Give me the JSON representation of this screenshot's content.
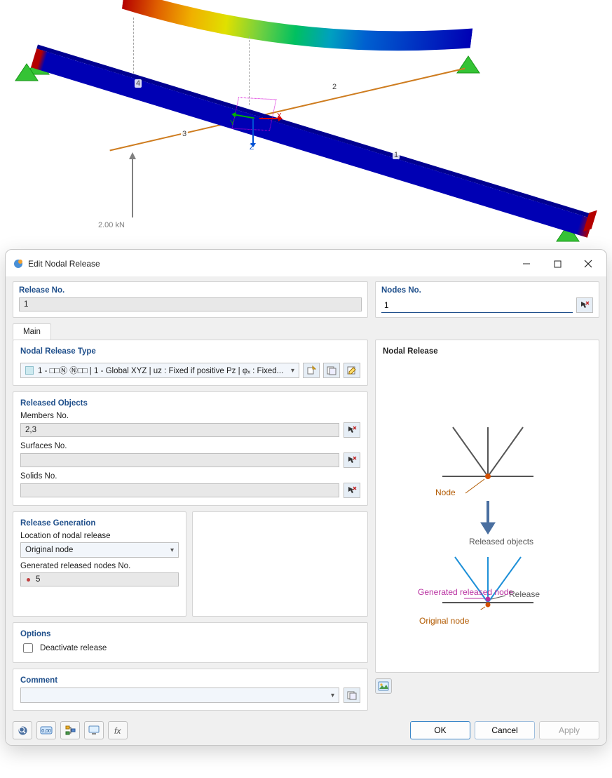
{
  "viewport": {
    "force_label": "2.00 kN",
    "member_labels": {
      "m1": "1",
      "m2": "2",
      "m3": "3",
      "m4": "4"
    },
    "axis": {
      "x": "X",
      "y": "Y",
      "z": "Z"
    }
  },
  "dialog": {
    "title": "Edit Nodal Release",
    "release_no": {
      "label": "Release No.",
      "value": "1"
    },
    "nodes_no": {
      "label": "Nodes No.",
      "value": "1"
    },
    "tab_main": "Main",
    "type": {
      "section": "Nodal Release Type",
      "value": "1 - □□Ⓝ Ⓝ□□ | 1 - Global XYZ | uᴢ : Fixed if positive Pᴢ | φₓ : Fixed..."
    },
    "released": {
      "section": "Released Objects",
      "members_label": "Members No.",
      "members_value": "2,3",
      "surfaces_label": "Surfaces No.",
      "surfaces_value": "",
      "solids_label": "Solids No.",
      "solids_value": ""
    },
    "generation": {
      "section": "Release Generation",
      "loc_label": "Location of nodal release",
      "loc_value": "Original node",
      "gen_label": "Generated released nodes No.",
      "gen_value": "5"
    },
    "options": {
      "section": "Options",
      "deactivate": "Deactivate release"
    },
    "comment": {
      "section": "Comment",
      "value": ""
    },
    "preview": {
      "title": "Nodal Release",
      "node": "Node",
      "released_objects": "Released objects",
      "generated": "Generated released node",
      "release": "Release",
      "original": "Original node"
    },
    "buttons": {
      "ok": "OK",
      "cancel": "Cancel",
      "apply": "Apply"
    }
  }
}
